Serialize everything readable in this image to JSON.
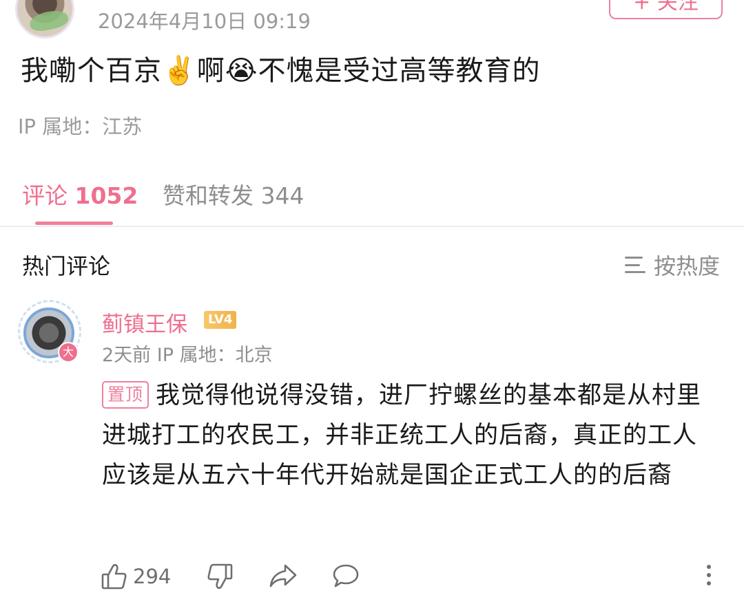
{
  "post": {
    "date": "2024年4月10日 09:19",
    "follow_label": "+ 关注",
    "text": "我嘞个百京✌️啊😭不愧是受过高等教育的",
    "ip": "IP 属地：江苏"
  },
  "tabs": {
    "comments_label": "评论",
    "comments_count": "1052",
    "likes_label": "赞和转发 344"
  },
  "hot_comments": {
    "title": "热门评论",
    "sort_label": "按热度"
  },
  "comment": {
    "username": "蓟镇王保",
    "level": "LV4",
    "avatar_badge": "大",
    "meta": "2天前  IP 属地：北京",
    "pin_label": "置顶",
    "text": "我觉得他说得没错，进厂拧螺丝的基本都是从村里进城打工的农民工，并非正统工人的后裔，真正的工人应该是从五六十年代开始就是国企正式工人的的后裔",
    "like_count": "294"
  },
  "icons": {
    "like": "thumbs-up-icon",
    "dislike": "thumbs-down-icon",
    "share": "share-icon",
    "reply": "comment-icon",
    "more": "more-vertical-icon",
    "sort": "sort-lines-icon"
  },
  "colors": {
    "accent": "#ef6f8f",
    "muted": "#8e8e8e"
  }
}
